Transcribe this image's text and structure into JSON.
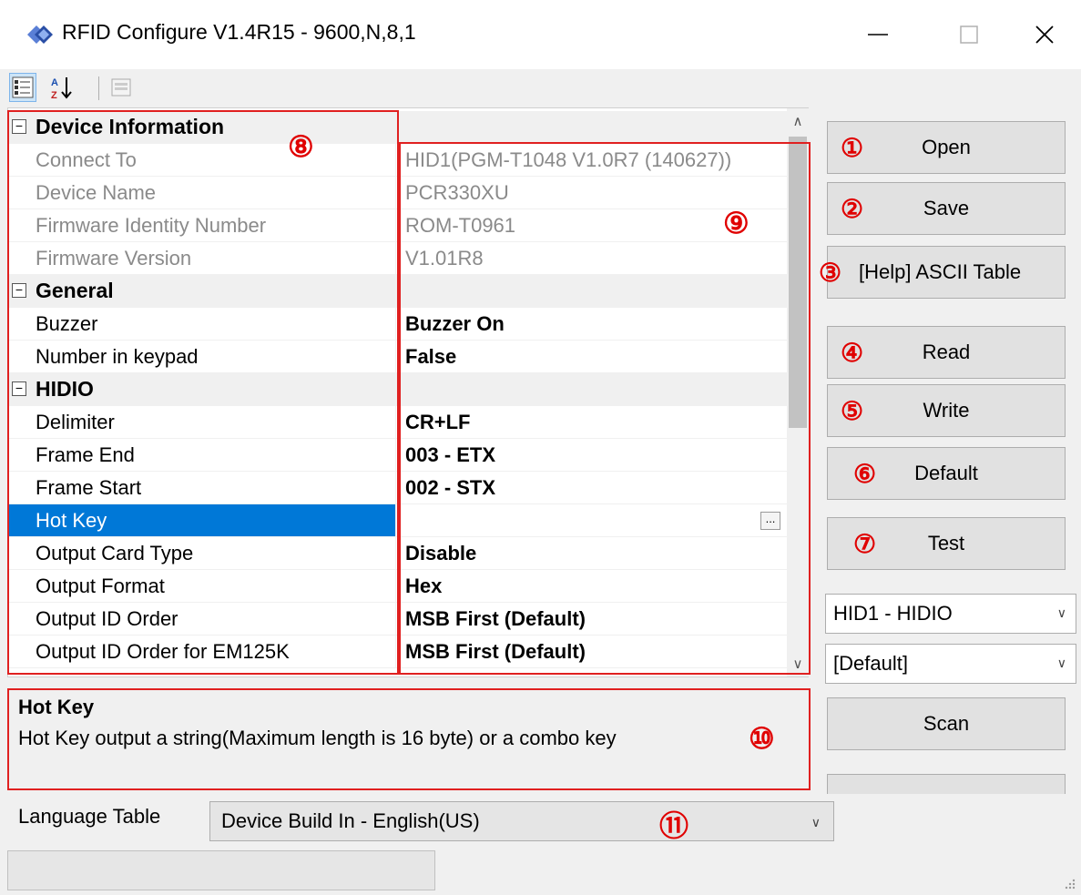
{
  "window": {
    "title": "RFID Configure V1.4R15 - 9600,N,8,1",
    "icon": "app-diamond-icon",
    "controls": {
      "minimize": "—",
      "maximize": "☐",
      "close": "✕"
    }
  },
  "toolbar": {
    "categorized_icon": "categorized-icon",
    "alphabetical_icon": "alphabetical-sort-icon",
    "property_pages_icon": "property-pages-icon"
  },
  "property_grid": {
    "categories": [
      {
        "name": "Device Information",
        "readonly": true,
        "items": [
          {
            "name": "Connect To",
            "value": "HID1(PGM-T1048 V1.0R7 (140627))"
          },
          {
            "name": "Device Name",
            "value": "PCR330XU"
          },
          {
            "name": "Firmware Identity Number",
            "value": "ROM-T0961"
          },
          {
            "name": "Firmware Version",
            "value": "V1.01R8"
          }
        ]
      },
      {
        "name": "General",
        "items": [
          {
            "name": "Buzzer",
            "value": "Buzzer On"
          },
          {
            "name": "Number in keypad",
            "value": "False"
          }
        ]
      },
      {
        "name": "HIDIO",
        "items": [
          {
            "name": "Delimiter",
            "value": "CR+LF"
          },
          {
            "name": "Frame End",
            "value": "003 - ETX"
          },
          {
            "name": "Frame Start",
            "value": "002 - STX"
          },
          {
            "name": "Hot Key",
            "value": "",
            "selected": true
          },
          {
            "name": "Output Card Type",
            "value": "Disable"
          },
          {
            "name": "Output Format",
            "value": "Hex"
          },
          {
            "name": "Output ID Order",
            "value": "MSB First (Default)"
          },
          {
            "name": "Output ID Order for EM125K",
            "value": "MSB First (Default)"
          }
        ]
      }
    ],
    "ellipsis": "..."
  },
  "description": {
    "title": "Hot Key",
    "text": "Hot Key output a string(Maximum length is 16 byte) or a combo key"
  },
  "annotations": {
    "n1": "①",
    "n2": "②",
    "n3": "③",
    "n4": "④",
    "n5": "⑤",
    "n6": "⑥",
    "n7": "⑦",
    "n8": "⑧",
    "n9": "⑨",
    "n10": "⑩",
    "n11": "⑪",
    "color": "#e00000"
  },
  "buttons": {
    "open": "Open",
    "save": "Save",
    "ascii": "[Help] ASCII Table",
    "read": "Read",
    "write": "Write",
    "default": "Default",
    "test": "Test",
    "scan": "Scan"
  },
  "selects": {
    "interface": "HID1 - HIDIO",
    "profile": "[Default]"
  },
  "language": {
    "label": "Language Table",
    "value": "Device Build In - English(US)"
  },
  "colors": {
    "selection": "#0078d7",
    "annotation_red": "#e02020"
  }
}
